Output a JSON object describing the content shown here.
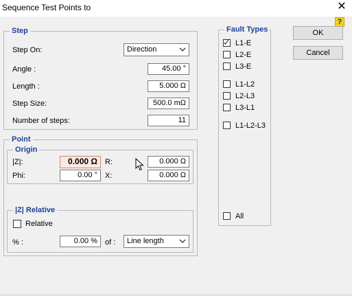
{
  "window": {
    "title": "Sequence Test Points to"
  },
  "step": {
    "legend": "Step",
    "step_on_label": "Step On:",
    "step_on_value": "Direction",
    "angle_label": "Angle :",
    "angle_value": "45.00 °",
    "length_label": "Length :",
    "length_value": "5.000 Ω",
    "step_size_label": "Step Size:",
    "step_size_value": "500.0 mΩ",
    "num_steps_label": "Number of steps:",
    "num_steps_value": "11"
  },
  "point": {
    "legend": "Point",
    "origin": {
      "legend": "Origin",
      "z_label": "|Z|:",
      "z_value": "0.000 Ω",
      "r_label": "R:",
      "r_value": "0.000 Ω",
      "phi_label": "Phi:",
      "phi_value": "0.00 °",
      "x_label": "X:",
      "x_value": "0.000 Ω"
    },
    "relative": {
      "legend": "|Z| Relative",
      "checkbox_label": "Relative",
      "checked": false,
      "percent_label": "% :",
      "percent_value": "0.00 %",
      "of_label": "of :",
      "of_value": "Line length"
    }
  },
  "fault_types": {
    "legend": "Fault Types",
    "items": [
      {
        "label": "L1-E",
        "checked": true
      },
      {
        "label": "L2-E",
        "checked": false
      },
      {
        "label": "L3-E",
        "checked": false
      },
      {
        "label": "L1-L2",
        "checked": false
      },
      {
        "label": "L2-L3",
        "checked": false
      },
      {
        "label": "L3-L1",
        "checked": false
      },
      {
        "label": "L1-L2-L3",
        "checked": false
      }
    ],
    "all": {
      "label": "All",
      "checked": false
    }
  },
  "buttons": {
    "ok": "OK",
    "cancel": "Cancel"
  },
  "icons": {
    "help": "?",
    "close": "✕",
    "tick": "✓"
  }
}
